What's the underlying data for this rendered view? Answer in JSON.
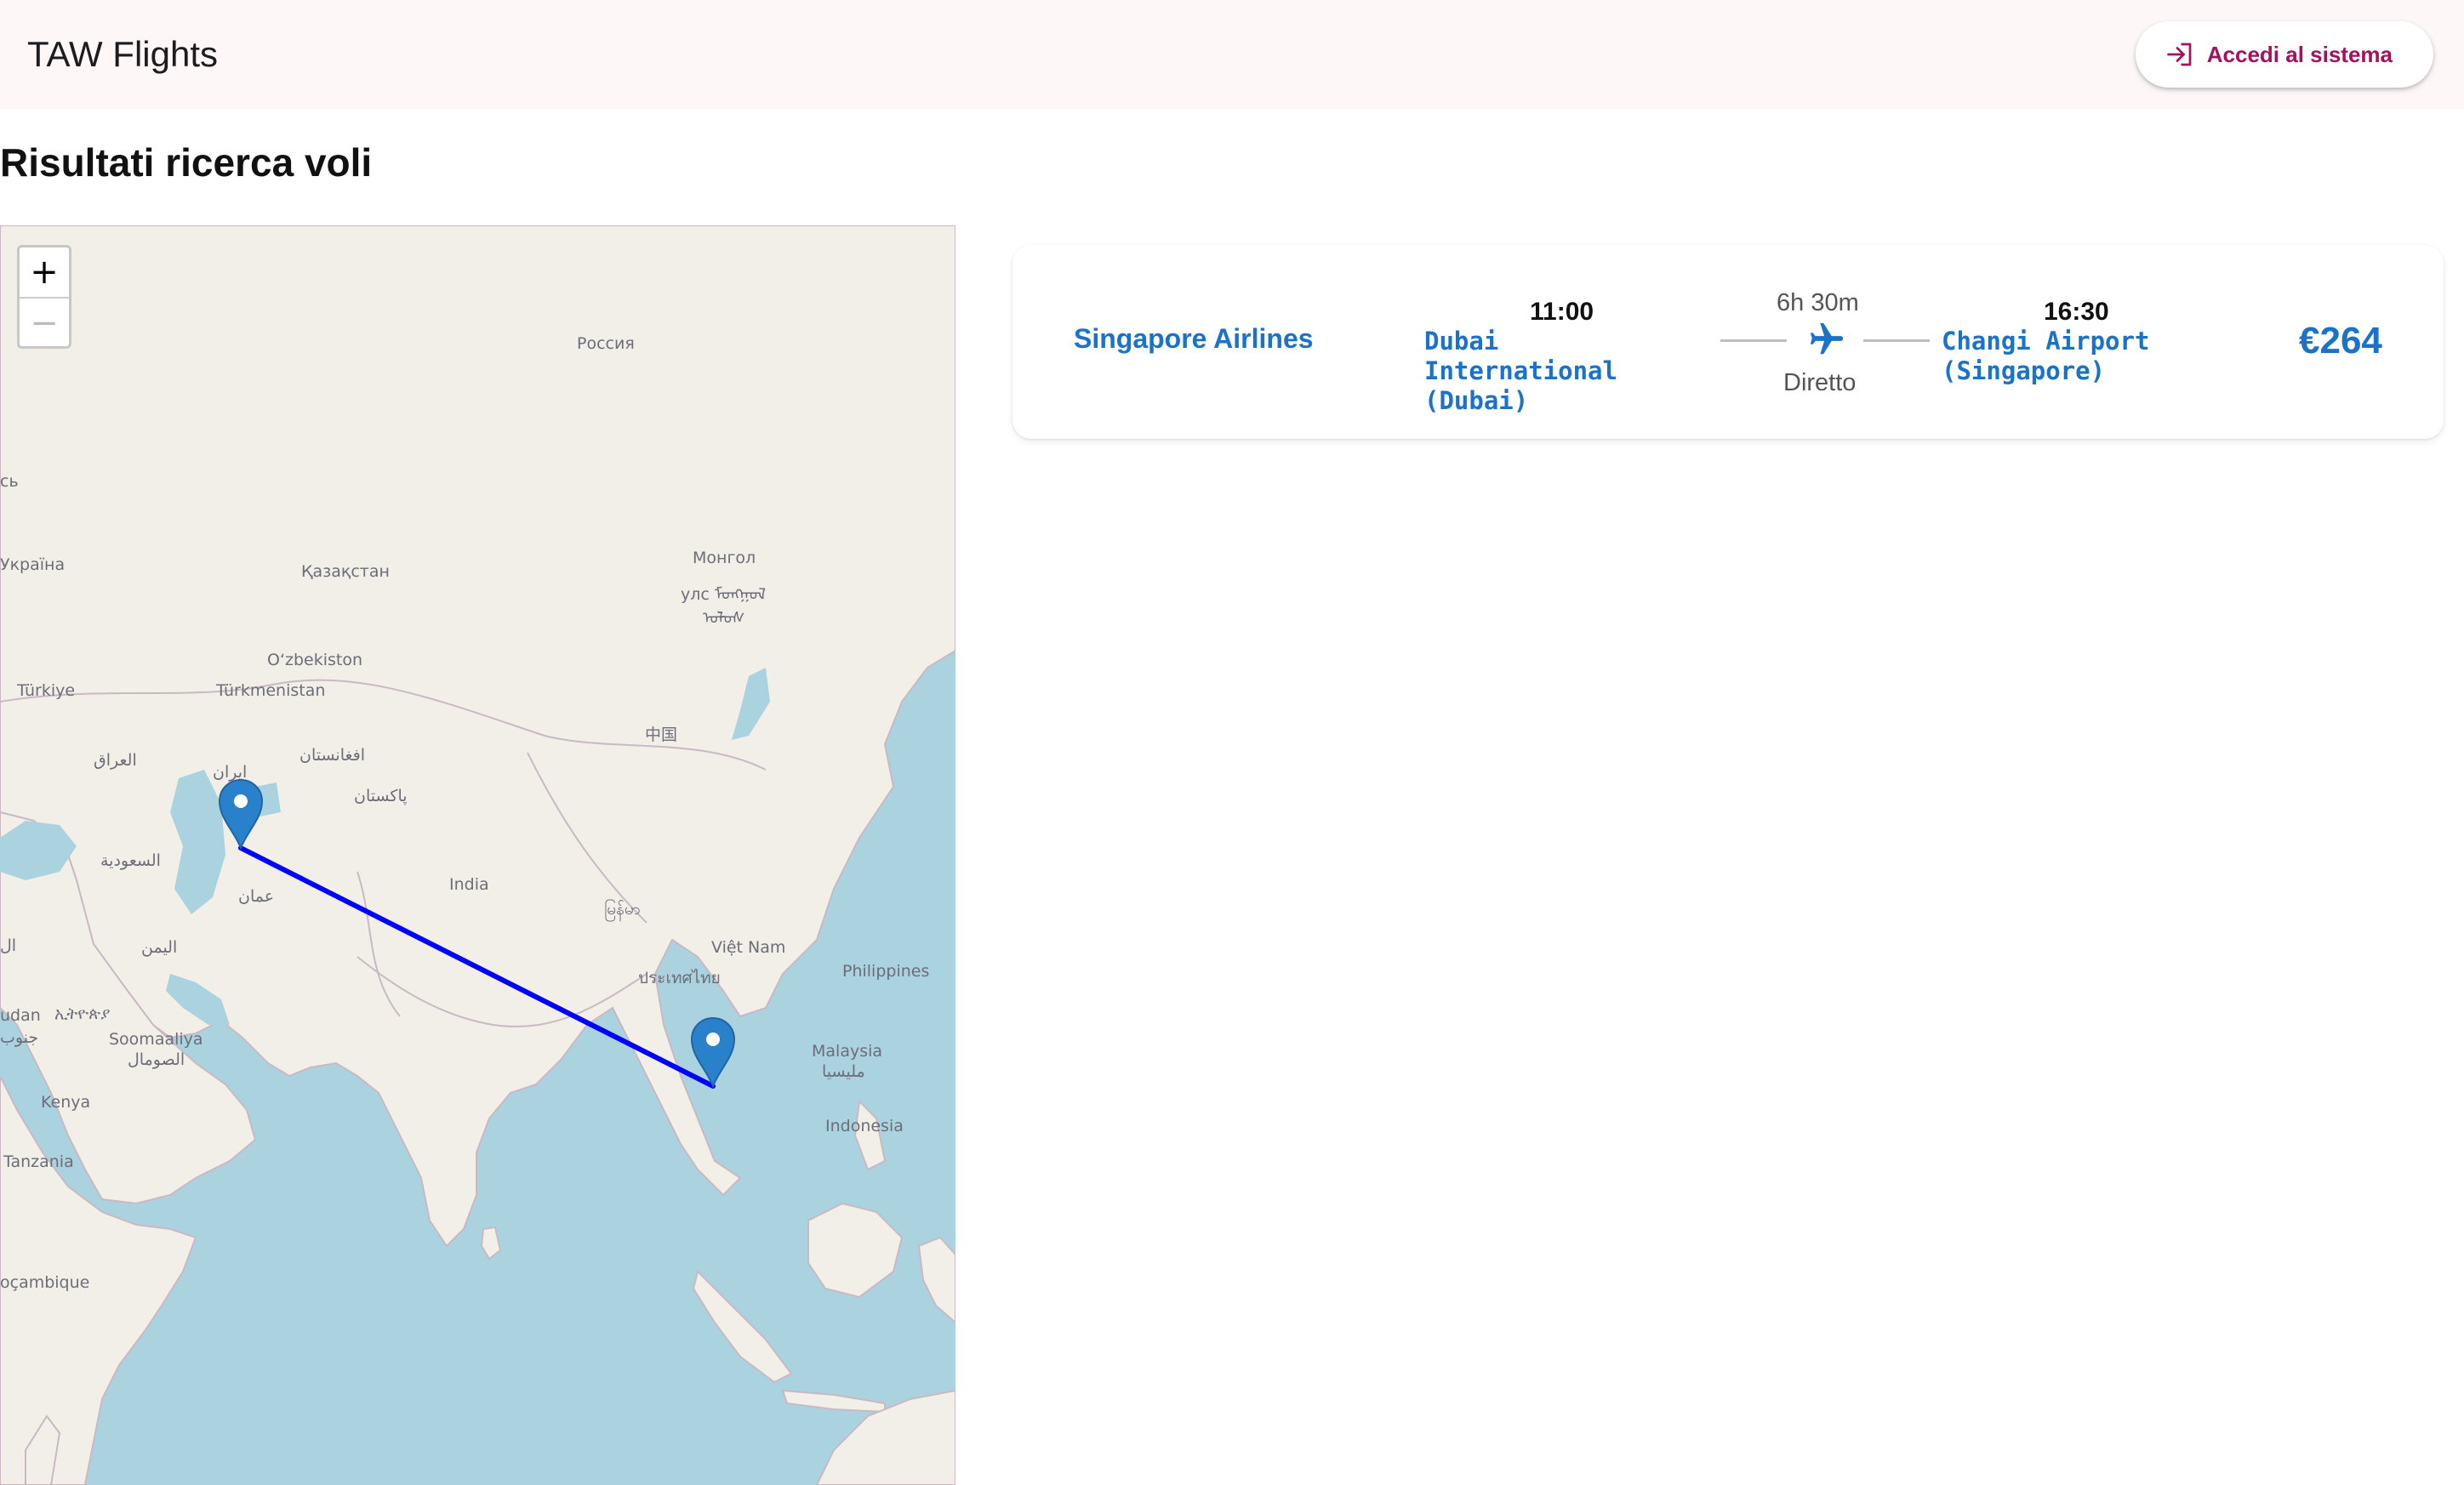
{
  "app": {
    "title": "TAW Flights",
    "login_label": "Accedi al sistema",
    "accent_color": "#a4115c"
  },
  "page": {
    "heading": "Risultati ricerca voli"
  },
  "map": {
    "zoom_in": "+",
    "zoom_out": "−",
    "route_color": "#0000ff",
    "marker_color": "#2a81cb",
    "labels": {
      "russia": "Россия",
      "ukraine": "Україна",
      "kazakhstan": "Қазақстан",
      "mongolia_1": "Монгол",
      "mongolia_2": "улс ᠮᠣᠩᠭᠣᠯ",
      "mongolia_3": "ᠤᠯᠤᠰ",
      "uzbekistan": "O‘zbekiston",
      "turkmenistan": "Türkmenistan",
      "turkiye": "Türkiye",
      "iraq": "العراق",
      "iran": "ایران",
      "afghanistan": "افغانستان",
      "pakistan": "پاکستان",
      "china": "中国",
      "saudi": "السعودية",
      "oman": "عمان",
      "india": "India",
      "myanmar": "မြန်မာ",
      "vietnam": "Việt Nam",
      "philippines": "Philippines",
      "yemen": "اليمن",
      "thailand": "ประเทศไทย",
      "sudan_fragment": "ال",
      "sudan": "udan",
      "ethiopia": "ኢትዮጵያ",
      "south_sudan": "جنوب",
      "somalia_1": "Soomaaliya",
      "somalia_2": "الصومال",
      "malaysia_1": "Malaysia",
      "malaysia_2": "مليسيا",
      "kenya": "Kenya",
      "indonesia": "Indonesia",
      "tanzania": "Tanzania",
      "mozambique": "oçambique",
      "belarus_fragment": "сь"
    }
  },
  "results": [
    {
      "airline": "Singapore Airlines",
      "departure_time": "11:00",
      "departure_airport": "Dubai International (Dubai)",
      "duration": "6h 30m",
      "stops": "Diretto",
      "arrival_time": "16:30",
      "arrival_airport": "Changi Airport (Singapore)",
      "price": "€264"
    }
  ]
}
